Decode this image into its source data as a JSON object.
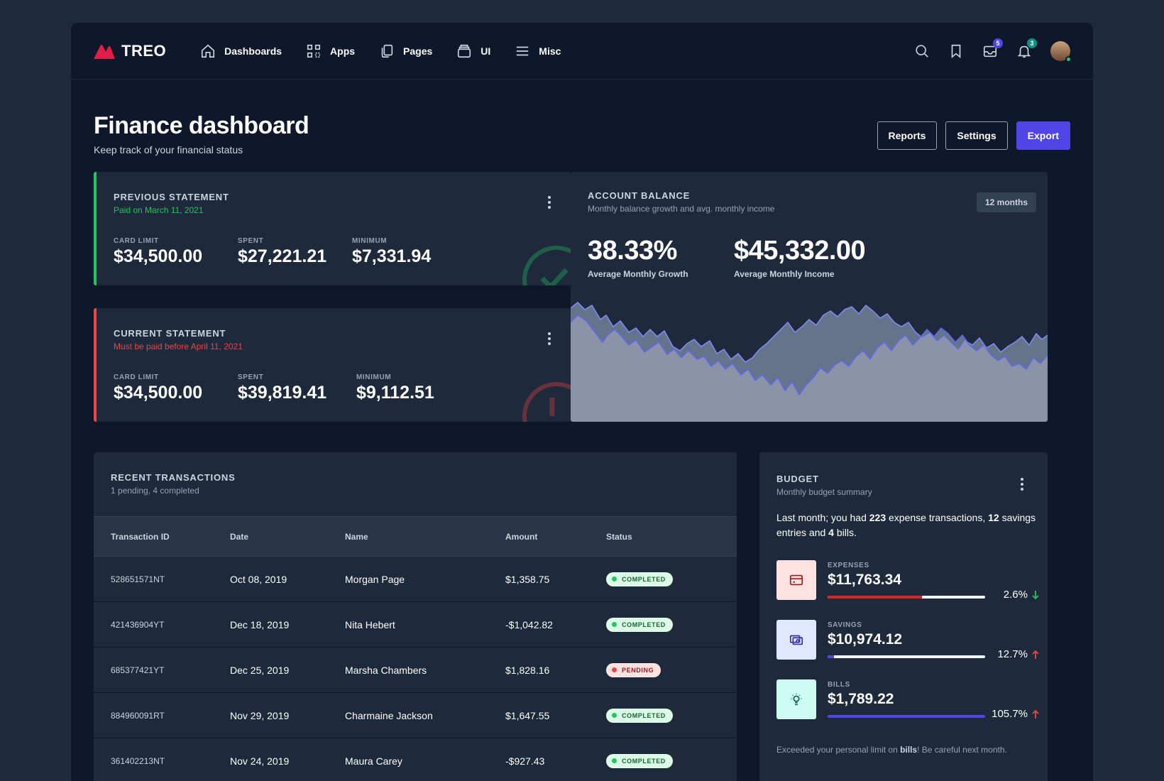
{
  "app": {
    "name": "TREO"
  },
  "nav": [
    {
      "label": "Dashboards",
      "icon": "home-icon"
    },
    {
      "label": "Apps",
      "icon": "apps-grid-icon"
    },
    {
      "label": "Pages",
      "icon": "pages-icon"
    },
    {
      "label": "UI",
      "icon": "stack-icon"
    },
    {
      "label": "Misc",
      "icon": "menu-icon"
    }
  ],
  "topbar": {
    "messages_count": "5",
    "notifications_count": "3"
  },
  "header": {
    "title": "Finance dashboard",
    "subtitle": "Keep track of your financial status",
    "reports_label": "Reports",
    "settings_label": "Settings",
    "export_label": "Export"
  },
  "previous_statement": {
    "title": "PREVIOUS STATEMENT",
    "note": "Paid on March 11, 2021",
    "card_limit_label": "CARD LIMIT",
    "card_limit": "$34,500.00",
    "spent_label": "SPENT",
    "spent": "$27,221.21",
    "minimum_label": "MINIMUM",
    "minimum": "$7,331.94"
  },
  "current_statement": {
    "title": "CURRENT STATEMENT",
    "note": "Must be paid before April 11, 2021",
    "card_limit_label": "CARD LIMIT",
    "card_limit": "$34,500.00",
    "spent_label": "SPENT",
    "spent": "$39,819.41",
    "minimum_label": "MINIMUM",
    "minimum": "$9,112.51"
  },
  "account_balance": {
    "title": "ACCOUNT BALANCE",
    "subtitle": "Monthly balance growth and avg. monthly income",
    "range": "12 months",
    "growth": "38.33%",
    "growth_label": "Average Monthly Growth",
    "income": "$45,332.00",
    "income_label": "Average Monthly Income"
  },
  "transactions": {
    "title": "RECENT TRANSACTIONS",
    "subtitle": "1 pending, 4 completed",
    "columns": [
      "Transaction ID",
      "Date",
      "Name",
      "Amount",
      "Status"
    ],
    "rows": [
      {
        "id": "528651571NT",
        "date": "Oct 08, 2019",
        "name": "Morgan Page",
        "amount": "$1,358.75",
        "status": "COMPLETED"
      },
      {
        "id": "421436904YT",
        "date": "Dec 18, 2019",
        "name": "Nita Hebert",
        "amount": "-$1,042.82",
        "status": "COMPLETED"
      },
      {
        "id": "685377421YT",
        "date": "Dec 25, 2019",
        "name": "Marsha Chambers",
        "amount": "$1,828.16",
        "status": "PENDING"
      },
      {
        "id": "884960091RT",
        "date": "Nov 29, 2019",
        "name": "Charmaine Jackson",
        "amount": "$1,647.55",
        "status": "COMPLETED"
      },
      {
        "id": "361402213NT",
        "date": "Nov 24, 2019",
        "name": "Maura Carey",
        "amount": "-$927.43",
        "status": "COMPLETED"
      }
    ]
  },
  "budget": {
    "title": "BUDGET",
    "subtitle": "Monthly budget summary",
    "summary_pre": "Last month; you had ",
    "expense_count": "223",
    "summary_mid1": " expense transactions, ",
    "savings_count": "12",
    "summary_mid2": " savings entries and ",
    "bills_count": "4",
    "summary_post": " bills.",
    "items": [
      {
        "label": "EXPENSES",
        "value": "$11,763.34",
        "progress": 0.6,
        "change": "2.6%",
        "trend": "down",
        "bar_color": "#dc2626",
        "trend_color": "#22c55e"
      },
      {
        "label": "SAVINGS",
        "value": "$10,974.12",
        "progress": 0.04,
        "change": "12.7%",
        "trend": "up",
        "bar_color": "#4f46e5",
        "trend_color": "#ef4444"
      },
      {
        "label": "BILLS",
        "value": "$1,789.22",
        "progress": 1.0,
        "change": "105.7%",
        "trend": "up",
        "bar_color": "#4f46e5",
        "trend_color": "#ef4444"
      }
    ],
    "note_pre": "Exceeded your personal limit on ",
    "note_bold": "bills",
    "note_post": "! Be careful next month."
  }
}
